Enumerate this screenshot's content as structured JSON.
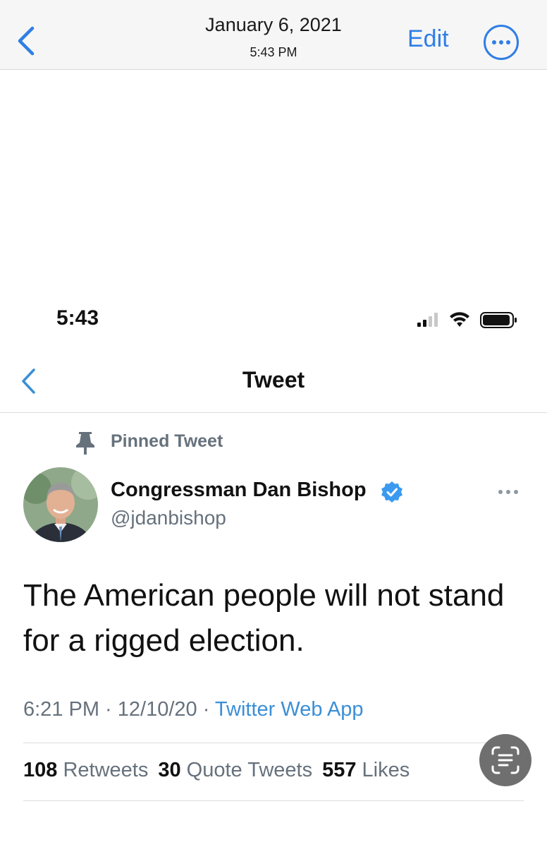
{
  "photos_header": {
    "date": "January 6, 2021",
    "time": "5:43 PM",
    "edit_label": "Edit",
    "accent_color": "#2f7ee6"
  },
  "status_bar": {
    "time": "5:43"
  },
  "tweet_nav": {
    "title": "Tweet"
  },
  "tweet": {
    "pinned_label": "Pinned Tweet",
    "author_name": "Congressman Dan Bishop",
    "author_handle": "@jdanbishop",
    "verified": true,
    "text": "The American people will not stand for a rigged election.",
    "time": "6:21 PM",
    "sep1": " · ",
    "date": "12/10/20",
    "sep2": " · ",
    "source": "Twitter Web App",
    "stats": {
      "retweets_count": "108",
      "retweets_label": "Retweets",
      "quotes_count": "30",
      "quotes_label": "Quote Tweets",
      "likes_count": "557",
      "likes_label": "Likes"
    }
  },
  "icons": {
    "back": "chevron-left-icon",
    "more": "ellipsis-circle-icon",
    "pin": "pin-icon",
    "verified": "verified-badge-icon",
    "live_text": "live-text-icon"
  }
}
